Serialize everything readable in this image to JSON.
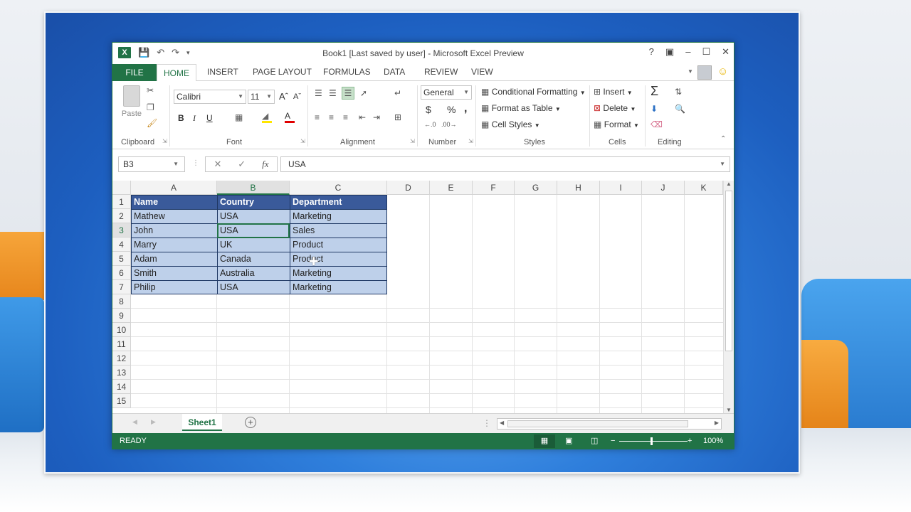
{
  "window": {
    "title": "Book1 [Last saved by user] - Microsoft Excel Preview",
    "logo": "X",
    "controls": [
      "?",
      "▣",
      "–",
      "☐",
      "✕"
    ]
  },
  "tabs": [
    "FILE",
    "HOME",
    "INSERT",
    "PAGE LAYOUT",
    "FORMULAS",
    "DATA",
    "REVIEW",
    "VIEW"
  ],
  "ribbon": {
    "clipboard": {
      "paste": "Paste",
      "label": "Clipboard"
    },
    "font": {
      "name": "Calibri",
      "size": "11",
      "bold": "B",
      "italic": "I",
      "underline": "U",
      "label": "Font"
    },
    "alignment": {
      "label": "Alignment"
    },
    "number": {
      "format": "General",
      "currency": "$",
      "percent": "%",
      "comma": ",",
      "label": "Number"
    },
    "styles": {
      "conditional": "Conditional Formatting",
      "table": "Format as Table",
      "cell": "Cell Styles",
      "label": "Styles"
    },
    "cells": {
      "insert": "Insert",
      "delete": "Delete",
      "format": "Format",
      "label": "Cells"
    },
    "editing": {
      "label": "Editing"
    }
  },
  "formula_bar": {
    "name_box": "B3",
    "value": "USA"
  },
  "columns": [
    "A",
    "B",
    "C",
    "D",
    "E",
    "F",
    "G",
    "H",
    "I",
    "J",
    "K"
  ],
  "rows": [
    "1",
    "2",
    "3",
    "4",
    "5",
    "6",
    "7",
    "8",
    "9",
    "10",
    "11",
    "12",
    "13",
    "14",
    "15"
  ],
  "table": {
    "headers": [
      "Name",
      "Country",
      "Department"
    ],
    "data": [
      [
        "Mathew",
        "USA",
        "Marketing"
      ],
      [
        "John",
        "USA",
        "Sales"
      ],
      [
        "Marry",
        "UK",
        "Product"
      ],
      [
        "Adam",
        "Canada",
        "Product"
      ],
      [
        "Smith",
        "Australia",
        "Marketing"
      ],
      [
        "Philip",
        "USA",
        "Marketing"
      ]
    ]
  },
  "sheet": {
    "tab": "Sheet1",
    "add": "+"
  },
  "status": {
    "state": "READY",
    "zoom": "100%"
  },
  "colors": {
    "excel_green": "#217346",
    "table_header": "#3a5a9a",
    "table_band": "#bed0ea"
  }
}
